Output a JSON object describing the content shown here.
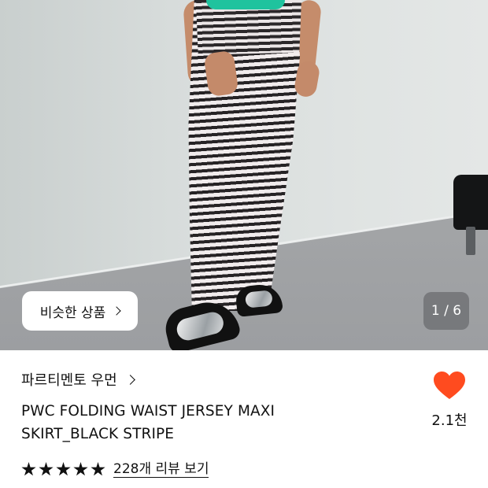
{
  "hero": {
    "similar_button_label": "비슷한 상품",
    "pager": "1 / 6"
  },
  "product": {
    "brand": "파르티멘토 우먼",
    "title_line1": "PWC FOLDING WAIST JERSEY MAXI",
    "title_line2": "SKIRT_BLACK STRIPE",
    "rating_stars": 5,
    "reviews_label": "228개 리뷰 보기",
    "like_count": "2.1천"
  },
  "colors": {
    "like_heart": "#ff4b1f",
    "accent_top": "#1fc39e"
  }
}
